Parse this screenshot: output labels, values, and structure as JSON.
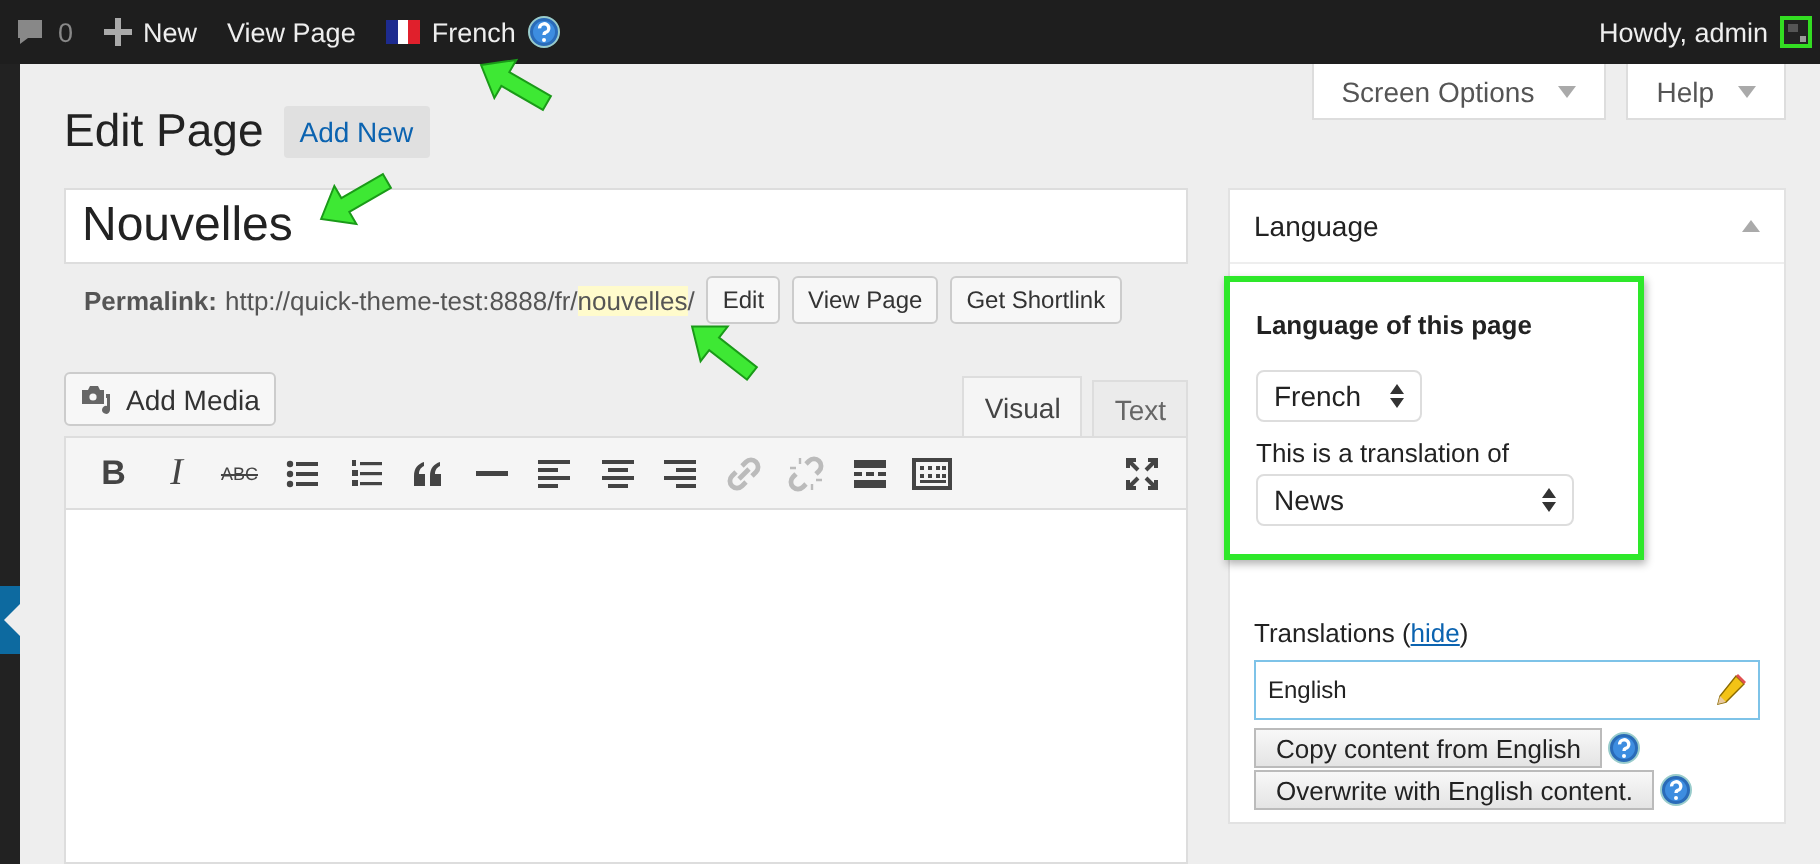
{
  "admin_bar": {
    "items": [
      {
        "kind": "comments",
        "text": "0"
      },
      {
        "kind": "new",
        "text": "New"
      },
      {
        "kind": "link",
        "text": "View Page"
      },
      {
        "kind": "language",
        "text": "French"
      }
    ],
    "greeting": "Howdy, admin"
  },
  "screen_tabs": [
    "Screen Options",
    "Help"
  ],
  "page_title": "Edit Page",
  "add_new": "Add New",
  "title_field": {
    "value": "Nouvelles"
  },
  "permalink": {
    "label": "Permalink:",
    "base": "http://quick-theme-test:8888/fr/",
    "slug": "nouvelles",
    "trail": "/",
    "buttons": [
      "Edit",
      "View Page",
      "Get Shortlink"
    ]
  },
  "add_media": "Add Media",
  "editor_tabs": [
    {
      "label": "Visual",
      "selected": true
    },
    {
      "label": "Text",
      "selected": false
    }
  ],
  "toolbar": [
    {
      "kind": "bold",
      "text": "B",
      "disabled": false
    },
    {
      "kind": "italic",
      "text": "I",
      "disabled": false
    },
    {
      "kind": "strike",
      "text": "ABC",
      "disabled": false
    },
    {
      "kind": "bullets",
      "disabled": false
    },
    {
      "kind": "numbers",
      "disabled": false
    },
    {
      "kind": "quote",
      "disabled": false
    },
    {
      "kind": "rule",
      "disabled": false
    },
    {
      "kind": "left",
      "disabled": false
    },
    {
      "kind": "center",
      "disabled": false
    },
    {
      "kind": "right",
      "disabled": false
    },
    {
      "kind": "link",
      "disabled": true
    },
    {
      "kind": "unlink",
      "disabled": true
    },
    {
      "kind": "more",
      "disabled": false
    },
    {
      "kind": "sink",
      "disabled": false
    },
    {
      "kind": "fullscreen",
      "disabled": false
    }
  ],
  "language_box": {
    "title": "Language",
    "heading": "Language of this page",
    "language_select": "French",
    "translation_label": "This is a translation of",
    "translation_select": "News",
    "translations_label": "Translations",
    "hide_brackets": [
      "(",
      ")"
    ],
    "hide_link": "hide",
    "translation_field": "English",
    "actions": [
      "Copy content from English",
      "Overwrite with English content."
    ]
  }
}
